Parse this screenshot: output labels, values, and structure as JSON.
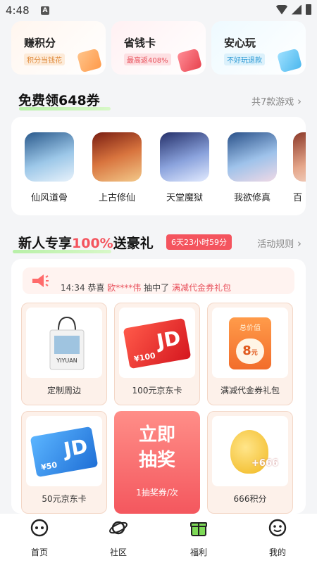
{
  "status_bar": {
    "time": "4:48"
  },
  "top_cards": [
    {
      "title": "赚积分",
      "tag": "积分当钱花"
    },
    {
      "title": "省钱卡",
      "tag": "最高返408%"
    },
    {
      "title": "安心玩",
      "tag": "不好玩退款"
    }
  ],
  "free_section": {
    "title_prefix": "免费领",
    "title_highlight": "648券",
    "link": "共7款游戏",
    "games": [
      {
        "name": "仙风道骨",
        "color": "#6fa6d6"
      },
      {
        "name": "上古修仙",
        "color": "#c4573a"
      },
      {
        "name": "天堂魔狱",
        "color": "#7d8fc9"
      },
      {
        "name": "我欲修真",
        "color": "#7aa9d8"
      },
      {
        "name": "百",
        "color": "#d9a38b"
      }
    ]
  },
  "newbie_section": {
    "title_prefix": "新人专享",
    "title_highlight": "100%",
    "title_suffix": "送豪礼",
    "countdown": "6天23小时59分",
    "link": "活动规则"
  },
  "ticker": {
    "time": "14:34",
    "verb": "恭喜",
    "user": "欧****伟",
    "action": "抽中了",
    "prize": "满减代金券礼包"
  },
  "prizes": [
    {
      "label": "定制周边",
      "bag_text": "YIYUAN"
    },
    {
      "label": "100元京东卡",
      "card_value": "¥100",
      "card_logo": "JD"
    },
    {
      "label": "满减代金券礼包",
      "coupon_head": "总价值",
      "coupon_amount": "8",
      "coupon_unit": "元"
    },
    {
      "label": "50元京东卡",
      "card_value": "¥50",
      "card_logo": "JD"
    },
    {
      "draw_line1": "立即",
      "draw_line2": "抽奖",
      "draw_sub": "1抽奖券/次"
    },
    {
      "label": "666积分",
      "points": "+666"
    }
  ],
  "tabbar": [
    {
      "label": "首页"
    },
    {
      "label": "社区"
    },
    {
      "label": "福利"
    },
    {
      "label": "我的"
    }
  ],
  "colors": {
    "accent": "#f4545e",
    "green_highlight": "#b8f0a8",
    "tab_active": "#4caf50"
  }
}
